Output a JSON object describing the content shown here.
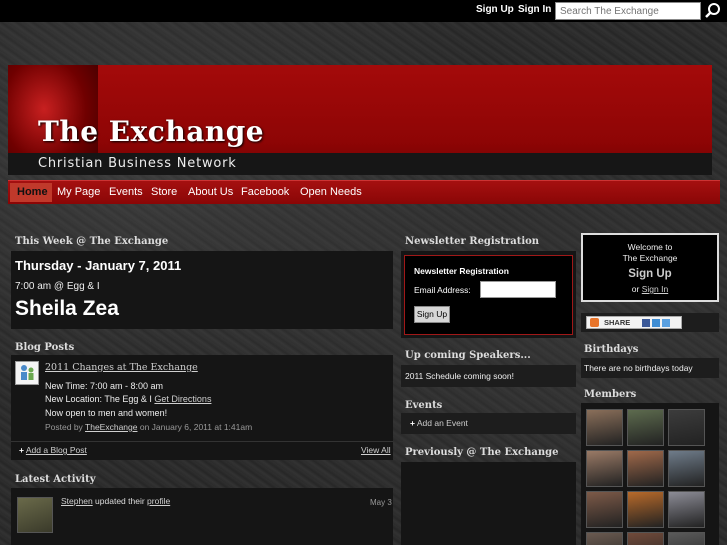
{
  "header": {
    "signup": "Sign Up",
    "signin": "Sign In",
    "search_placeholder": "Search The Exchange"
  },
  "banner": {
    "title": "The Exchange",
    "subtitle": "Christian Business Network"
  },
  "nav": {
    "items": [
      {
        "label": "Home"
      },
      {
        "label": "My Page"
      },
      {
        "label": "Events"
      },
      {
        "label": "Store"
      },
      {
        "label": "About Us"
      },
      {
        "label": "Facebook"
      },
      {
        "label": "Open Needs"
      }
    ]
  },
  "this_week": {
    "heading": "This Week @ The Exchange",
    "date": "Thursday - January 7, 2011",
    "time_location": "7:00 am @ Egg & I",
    "speaker": "Sheila Zea"
  },
  "blog": {
    "heading": "Blog Posts",
    "post_title": "2011 Changes at The Exchange",
    "line1": "New Time: 7:00 am - 8:00 am",
    "line2_prefix": "New Location: The Egg & I",
    "line2_link": "Get Directions",
    "line3": "Now open to men and women!",
    "posted_by_prefix": "Posted by",
    "posted_by_author": "TheExchange",
    "posted_by_suffix": "on January 6, 2011 at 1:41am",
    "add_post": "Add a Blog Post",
    "view_all": "View All"
  },
  "activity": {
    "heading": "Latest Activity",
    "user": "Stephen",
    "action": "updated their",
    "target": "profile",
    "date": "May 3"
  },
  "newsletter": {
    "heading": "Newsletter Registration",
    "box_title": "Newsletter Registration",
    "email_label": "Email Address:",
    "email_value": "",
    "signup_button": "Sign Up"
  },
  "speakers": {
    "heading": "Up coming Speakers...",
    "text": "2011 Schedule coming soon!"
  },
  "events": {
    "heading": "Events",
    "add_event": "Add an Event"
  },
  "previously": {
    "heading": "Previously @ The Exchange"
  },
  "welcome": {
    "line1": "Welcome to",
    "line2": "The Exchange",
    "signup": "Sign Up",
    "or": "or",
    "signin": "Sign In"
  },
  "share": {
    "label": "SHARE"
  },
  "birthdays": {
    "heading": "Birthdays",
    "text": "There are no birthdays today"
  },
  "members": {
    "heading": "Members",
    "avatar_colors": [
      "#8a6f5a",
      "#5d6b4e",
      "#3c3c3c",
      "#9a7a66",
      "#a0694a",
      "#6f7c8a",
      "#7d5a48",
      "#b86a2a",
      "#8c8c96",
      "#6a5a50",
      "#704a3a",
      "#5a5a5a"
    ]
  }
}
